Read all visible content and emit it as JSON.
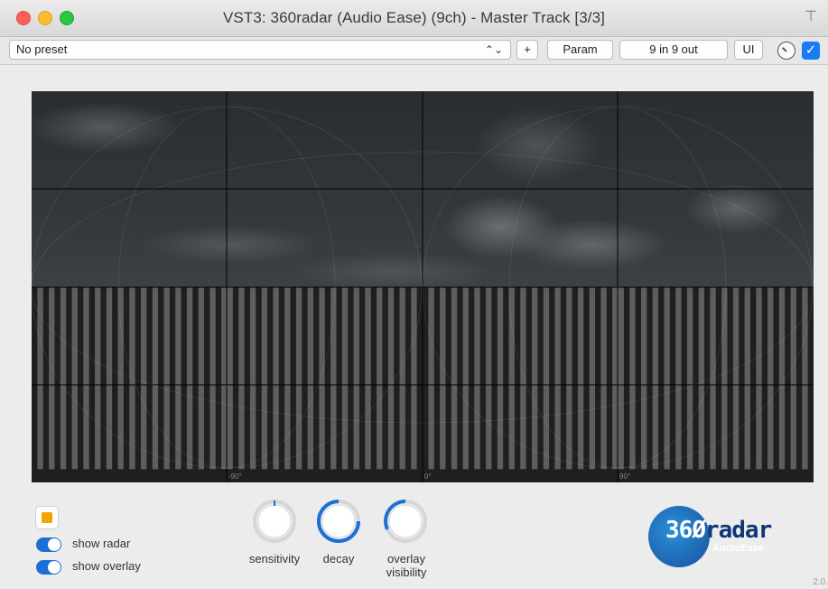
{
  "window": {
    "title": "VST3: 360radar (Audio Ease) (9ch) - Master Track [3/3]"
  },
  "toolbar": {
    "preset": "No preset",
    "plus_label": "+",
    "param_label": "Param",
    "io_label": "9 in 9 out",
    "ui_label": "UI"
  },
  "view": {
    "degree_labels": [
      "-90°",
      "0°",
      "90°"
    ]
  },
  "controls": {
    "show_radar_label": "show radar",
    "show_overlay_label": "show overlay",
    "show_radar_on": true,
    "show_overlay_on": true,
    "knobs": [
      {
        "label": "sensitivity"
      },
      {
        "label": "decay"
      },
      {
        "label": "overlay visibility"
      }
    ]
  },
  "brand": {
    "logo_text_a": "36",
    "logo_text_b": "radar",
    "logo_sub": "AudioEase",
    "version": "2.0."
  },
  "colors": {
    "accent": "#1d6fd8",
    "orange": "#f5a300",
    "logo_dark": "#0f3778"
  }
}
